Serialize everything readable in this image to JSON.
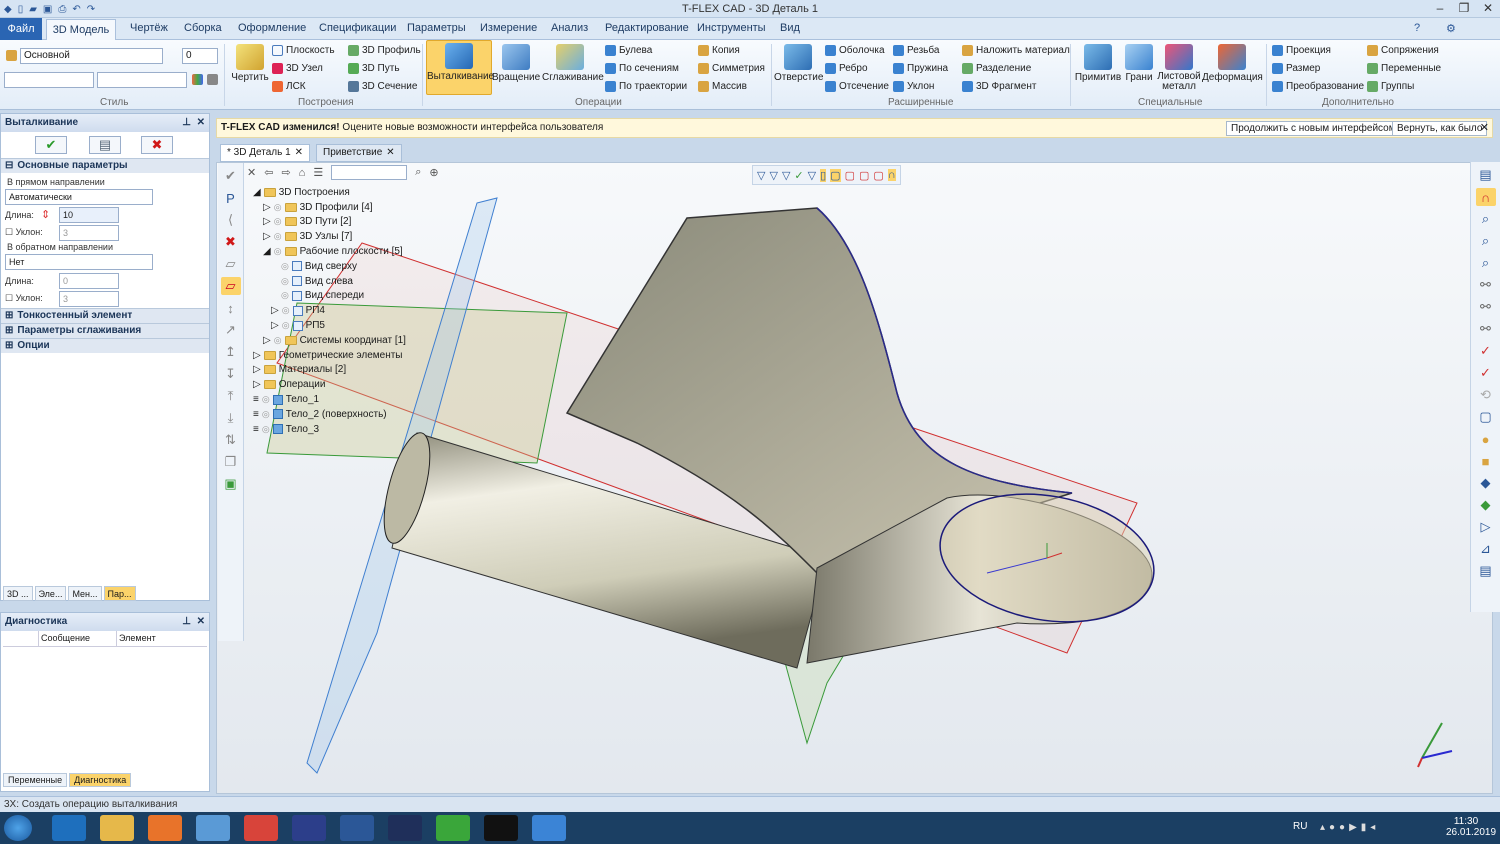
{
  "app": {
    "title": "T-FLEX CAD - 3D Деталь 1"
  },
  "menu": {
    "file": "Файл",
    "tabs": [
      "3D Модель",
      "Чертёж",
      "Сборка",
      "Оформление",
      "Спецификации",
      "Параметры",
      "Измерение",
      "Анализ",
      "Редактирование",
      "Инструменты",
      "Вид"
    ]
  },
  "ribbon": {
    "style": {
      "layer": "Основной",
      "level": "0",
      "group": "Стиль"
    },
    "build": {
      "draw": "Чертить",
      "items": [
        "Плоскость",
        "3D Узел",
        "ЛСК",
        "3D Профиль",
        "3D Путь",
        "3D Сечение"
      ],
      "group": "Построения"
    },
    "ops": {
      "extrude": "Выталкивание",
      "rotate": "Вращение",
      "smooth": "Сглаживание",
      "items": [
        "Булева",
        "По сечениям",
        "По траектории",
        "Копия",
        "Симметрия",
        "Массив"
      ],
      "group": "Операции"
    },
    "ext": {
      "hole": "Отверстие",
      "items": [
        "Оболочка",
        "Ребро",
        "Отсечение",
        "Резьба",
        "Пружина",
        "Уклон",
        "Наложить материал",
        "Разделение",
        "3D Фрагмент"
      ],
      "group": "Расширенные"
    },
    "spec": {
      "items": [
        "Примитив",
        "Грани",
        "Листовой металл",
        "Деформация"
      ],
      "group": "Специальные"
    },
    "extra": {
      "items": [
        "Проекция",
        "Размер",
        "Преобразование",
        "Сопряжения",
        "Переменные",
        "Группы"
      ],
      "group": "Дополнительно"
    }
  },
  "left": {
    "title": "Выталкивание",
    "sections": {
      "main": "Основные параметры",
      "thin": "Тонкостенный элемент",
      "smooth": "Параметры сглаживания",
      "opts": "Опции"
    },
    "forward": "В прямом направлении",
    "mode1": "Автоматически",
    "length_label": "Длина:",
    "length": "10",
    "slope_label": "Уклон:",
    "slope": "3",
    "backward": "В обратном направлении",
    "mode2": "Нет",
    "length2": "0",
    "slope2": "3",
    "tabs": [
      "3D ...",
      "Эле...",
      "Мен...",
      "Пар..."
    ]
  },
  "diag": {
    "title": "Диагностика",
    "cols": [
      "Сообщение",
      "Элемент"
    ],
    "tabs": [
      "Переменные",
      "Диагностика"
    ]
  },
  "notice": {
    "text_bold": "T-FLEX CAD изменился!",
    "text": " Оцените новые возможности интерфейса пользователя",
    "btn1": "Продолжить с новым интерфейсом",
    "btn2": "Вернуть, как было"
  },
  "doctabs": [
    "* 3D Деталь 1",
    "Приветствие"
  ],
  "tree": [
    "3D Построения",
    "3D Профили [4]",
    "3D Пути [2]",
    "3D Узлы [7]",
    "Рабочие плоскости [5]",
    "Вид сверху",
    "Вид слева",
    "Вид спереди",
    "РП4",
    "РП5",
    "Системы координат [1]",
    "Геометрические элементы",
    "Материалы [2]",
    "Операции",
    "Тело_1",
    "Тело_2 (поверхность)",
    "Тело_3"
  ],
  "status": "3Х: Создать операцию выталкивания",
  "tray": {
    "lang": "RU",
    "time": "11:30",
    "date": "26.01.2019"
  }
}
